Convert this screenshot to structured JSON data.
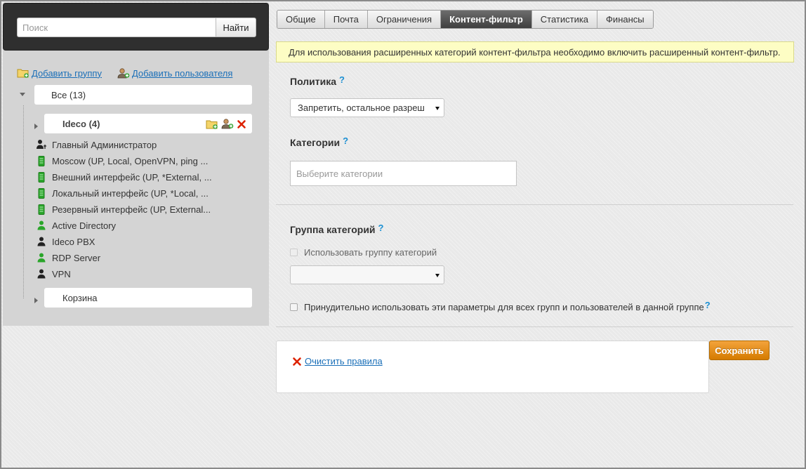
{
  "search": {
    "placeholder": "Поиск",
    "button": "Найти"
  },
  "actions": {
    "add_group": "Добавить группу",
    "add_user": "Добавить пользователя"
  },
  "tree": {
    "root": "Все (13)",
    "group": "Ideco (4)",
    "items": [
      {
        "label": "Главный Администратор",
        "icon": "admin-user-icon",
        "color": "#222222"
      },
      {
        "label": "Moscow (UP, Local, OpenVPN, ping ...",
        "icon": "server-icon",
        "color": "#2aa52a"
      },
      {
        "label": "Внешний интерфейс (UP, *External, ...",
        "icon": "server-icon",
        "color": "#2aa52a"
      },
      {
        "label": "Локальный интерфейс (UP, *Local, ...",
        "icon": "server-icon",
        "color": "#2aa52a"
      },
      {
        "label": "Резервный интерфейс (UP, External...",
        "icon": "server-icon",
        "color": "#2aa52a"
      },
      {
        "label": "Active Directory",
        "icon": "user-icon",
        "color": "#2aa52a"
      },
      {
        "label": "Ideco PBX",
        "icon": "user-icon",
        "color": "#222222"
      },
      {
        "label": "RDP Server",
        "icon": "user-icon",
        "color": "#2aa52a"
      },
      {
        "label": "VPN",
        "icon": "user-icon",
        "color": "#222222"
      }
    ],
    "trash": "Корзина"
  },
  "tabs": [
    "Общие",
    "Почта",
    "Ограничения",
    "Контент-фильтр",
    "Статистика",
    "Финансы"
  ],
  "active_tab": "Контент-фильтр",
  "notice": "Для использования расширенных категорий контент-фильтра необходимо включить расширенный контент-фильтр.",
  "policy": {
    "title": "Политика",
    "help": "?",
    "value": "Запретить, остальное разреш"
  },
  "categories": {
    "title": "Категории",
    "help": "?",
    "placeholder": "Выберите категории"
  },
  "category_group": {
    "title": "Группа категорий",
    "help": "?",
    "use_checkbox": "Использовать группу категорий",
    "select_value": ""
  },
  "force": {
    "label": "Принудительно использовать эти параметры для всех групп и пользователей в данной группе",
    "help": "?"
  },
  "clear_rules": "Очистить правила",
  "save": "Сохранить",
  "colors": {
    "accent": "#e08a12",
    "link": "#1a6fb8",
    "help": "#1a8fd3",
    "green": "#2aa52a",
    "delete": "#dd2200"
  }
}
